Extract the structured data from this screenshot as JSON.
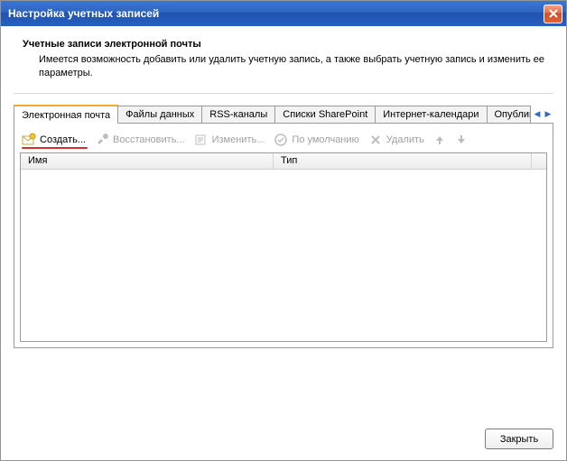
{
  "window": {
    "title": "Настройка учетных записей"
  },
  "header": {
    "title": "Учетные записи электронной почты",
    "description": "Имеется возможность добавить или удалить учетную запись, а также выбрать учетную запись и изменить ее параметры."
  },
  "tabs": [
    {
      "label": "Электронная почта",
      "active": true
    },
    {
      "label": "Файлы данных"
    },
    {
      "label": "RSS-каналы"
    },
    {
      "label": "Списки SharePoint"
    },
    {
      "label": "Интернет-календари"
    },
    {
      "label": "Опубликован"
    }
  ],
  "toolbar": {
    "create": "Создать...",
    "restore": "Восстановить...",
    "edit": "Изменить...",
    "default": "По умолчанию",
    "delete": "Удалить"
  },
  "columns": {
    "name": "Имя",
    "type": "Тип"
  },
  "footer": {
    "close": "Закрыть"
  }
}
